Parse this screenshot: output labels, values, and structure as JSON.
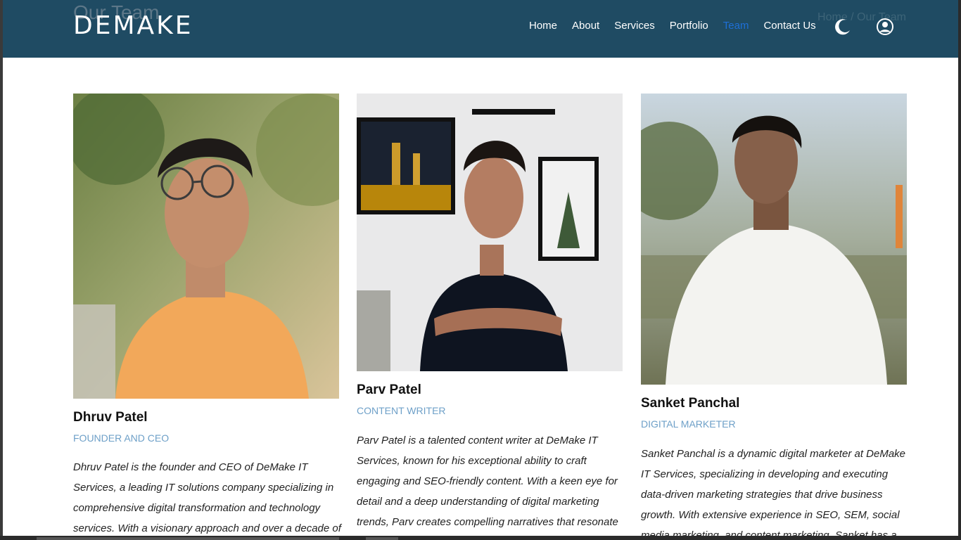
{
  "header": {
    "logo": "DEMAKE",
    "ghost_title": "Our Team",
    "ghost_breadcrumb": "Home  /  Our Team",
    "nav": [
      "Home",
      "About",
      "Services",
      "Portfolio",
      "Team",
      "Contact Us"
    ],
    "active_nav": "Team",
    "colors": {
      "header_bg": "#1f4b63",
      "active_link": "#1e6fd6",
      "role_text": "#6ea0c8"
    }
  },
  "team": [
    {
      "name": "Dhruv Patel",
      "role": "FOUNDER AND CEO",
      "bio": "Dhruv Patel is the founder and CEO of DeMake IT Services, a leading IT solutions company specializing in comprehensive digital transformation and technology services. With a visionary approach and over a decade of"
    },
    {
      "name": "Parv Patel",
      "role": "CONTENT WRITER",
      "bio": "Parv Patel is a talented content writer at DeMake IT Services, known for his exceptional ability to craft engaging and SEO-friendly content. With a keen eye for detail and a deep understanding of digital marketing trends, Parv creates compelling narratives that resonate"
    },
    {
      "name": "Sanket Panchal",
      "role": "DIGITAL MARKETER",
      "bio": "Sanket Panchal is a dynamic digital marketer at DeMake IT Services, specializing in developing and executing data-driven marketing strategies that drive business growth. With extensive experience in SEO, SEM, social media marketing, and content marketing, Sanket has a"
    }
  ]
}
